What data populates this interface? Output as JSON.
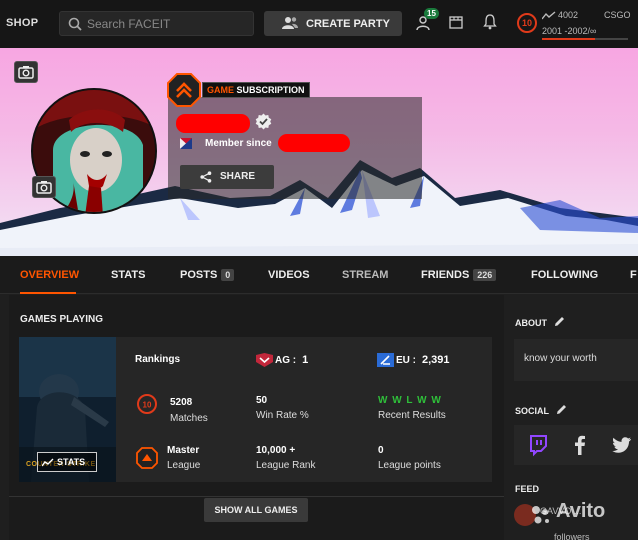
{
  "topbar": {
    "shop_label": "SHOP",
    "search_placeholder": "Search FACEIT",
    "create_party_label": "CREATE PARTY",
    "friends_count": "15",
    "skill_level": "10",
    "elo_value": "4002",
    "game_name": "CSGO",
    "elo_range": "2001    -2002/∞",
    "elo_progress": 0.62
  },
  "banner": {
    "subscription_word1": "GAME",
    "subscription_word2": " SUBSCRIPTION",
    "member_since_label": "Member since",
    "share_label": "SHARE"
  },
  "tabs": [
    {
      "label": "OVERVIEW"
    },
    {
      "label": "STATS"
    },
    {
      "label": "POSTS",
      "badge": "0"
    },
    {
      "label": "VIDEOS"
    },
    {
      "label": "STREAM"
    },
    {
      "label": "FRIENDS",
      "badge": "226"
    },
    {
      "label": "FOLLOWING"
    },
    {
      "label": "F"
    }
  ],
  "games": {
    "heading": "GAMES PLAYING",
    "cover_stats_label": "STATS",
    "cover_logo_text": "COUNTER-STRIKE",
    "rankings_label": "Rankings",
    "rank_ag": {
      "label": "AG :",
      "value": "1"
    },
    "rank_eu": {
      "label": "EU :",
      "value": "2,391"
    },
    "stats": [
      {
        "value": "5208",
        "label": "Matches"
      },
      {
        "value": "50",
        "label": "Win Rate %"
      },
      {
        "value": "W W L W W",
        "label": "Recent Results"
      },
      {
        "value": "Master",
        "label": "League"
      },
      {
        "value": "10,000 +",
        "label": "League Rank"
      },
      {
        "value": "0",
        "label": "League points"
      }
    ],
    "show_all_label": "SHOW ALL GAMES"
  },
  "side": {
    "about_heading": "ABOUT",
    "about_text": "know your worth",
    "social_heading": "SOCIAL",
    "feed_heading": "FEED",
    "feed_text": "GAVVO ...",
    "feed_followers": "followers"
  },
  "watermark": "Avito",
  "colors": {
    "accent": "#ff5500",
    "win": "#2fbf3a",
    "level": "#e03a1a"
  }
}
